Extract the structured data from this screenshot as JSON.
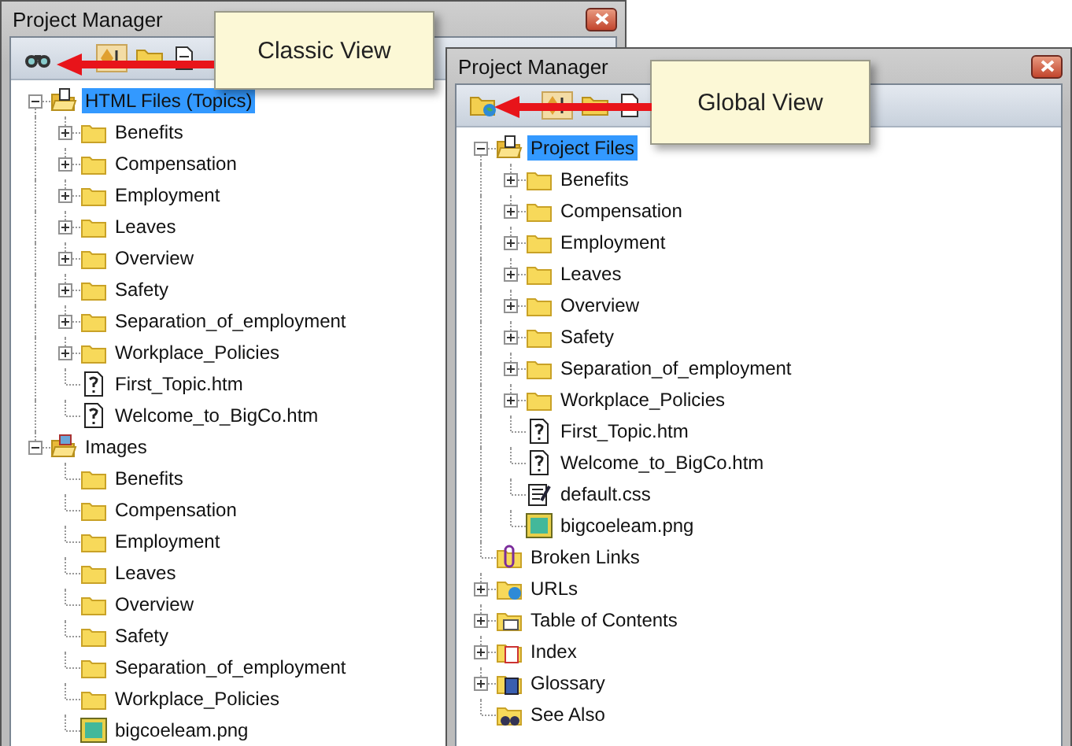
{
  "windows": [
    {
      "title": "Project Manager",
      "callout": "Classic View",
      "tree": [
        {
          "label": "HTML Files (Topics)",
          "kind": "topics",
          "selected": true,
          "expanded": true,
          "children": [
            {
              "label": "Benefits",
              "kind": "folder",
              "selected": false,
              "expanded": false
            },
            {
              "label": "Compensation",
              "kind": "folder",
              "selected": false,
              "expanded": false
            },
            {
              "label": "Employment",
              "kind": "folder",
              "selected": false,
              "expanded": false
            },
            {
              "label": "Leaves",
              "kind": "folder",
              "selected": false,
              "expanded": false
            },
            {
              "label": "Overview",
              "kind": "folder",
              "selected": false,
              "expanded": false
            },
            {
              "label": "Safety",
              "kind": "folder",
              "selected": false,
              "expanded": false
            },
            {
              "label": "Separation_of_employment",
              "kind": "folder",
              "selected": false,
              "expanded": false
            },
            {
              "label": "Workplace_Policies",
              "kind": "folder",
              "selected": false,
              "expanded": false
            },
            {
              "label": "First_Topic.htm",
              "kind": "topic",
              "selected": false
            },
            {
              "label": "Welcome_to_BigCo.htm",
              "kind": "topic",
              "selected": false
            }
          ]
        },
        {
          "label": "Images",
          "kind": "images",
          "selected": false,
          "expanded": true,
          "children": [
            {
              "label": "Benefits",
              "kind": "folder",
              "selected": false
            },
            {
              "label": "Compensation",
              "kind": "folder",
              "selected": false
            },
            {
              "label": "Employment",
              "kind": "folder",
              "selected": false
            },
            {
              "label": "Leaves",
              "kind": "folder",
              "selected": false
            },
            {
              "label": "Overview",
              "kind": "folder",
              "selected": false
            },
            {
              "label": "Safety",
              "kind": "folder",
              "selected": false
            },
            {
              "label": "Separation_of_employment",
              "kind": "folder",
              "selected": false
            },
            {
              "label": "Workplace_Policies",
              "kind": "folder",
              "selected": false
            },
            {
              "label": "bigcoeleam.png",
              "kind": "image",
              "selected": false
            }
          ]
        }
      ]
    },
    {
      "title": "Project Manager",
      "callout": "Global View",
      "tree": [
        {
          "label": "Project Files",
          "kind": "topics",
          "selected": true,
          "expanded": true,
          "children": [
            {
              "label": "Benefits",
              "kind": "folder",
              "selected": false,
              "expanded": false
            },
            {
              "label": "Compensation",
              "kind": "folder",
              "selected": false,
              "expanded": false
            },
            {
              "label": "Employment",
              "kind": "folder",
              "selected": false,
              "expanded": false
            },
            {
              "label": "Leaves",
              "kind": "folder",
              "selected": false,
              "expanded": false
            },
            {
              "label": "Overview",
              "kind": "folder",
              "selected": false,
              "expanded": false
            },
            {
              "label": "Safety",
              "kind": "folder",
              "selected": false,
              "expanded": false
            },
            {
              "label": "Separation_of_employment",
              "kind": "folder",
              "selected": false,
              "expanded": false
            },
            {
              "label": "Workplace_Policies",
              "kind": "folder",
              "selected": false,
              "expanded": false
            },
            {
              "label": "First_Topic.htm",
              "kind": "topic",
              "selected": false
            },
            {
              "label": "Welcome_to_BigCo.htm",
              "kind": "topic",
              "selected": false
            },
            {
              "label": "default.css",
              "kind": "css",
              "selected": false
            },
            {
              "label": "bigcoeleam.png",
              "kind": "image",
              "selected": false
            }
          ]
        },
        {
          "label": "Broken Links",
          "kind": "broken-links",
          "selected": false
        },
        {
          "label": "URLs",
          "kind": "urls",
          "selected": false,
          "expanded": false
        },
        {
          "label": "Table of Contents",
          "kind": "toc",
          "selected": false,
          "expanded": false
        },
        {
          "label": "Index",
          "kind": "index",
          "selected": false,
          "expanded": false
        },
        {
          "label": "Glossary",
          "kind": "glossary",
          "selected": false,
          "expanded": false
        },
        {
          "label": "See Also",
          "kind": "see-also",
          "selected": false
        }
      ]
    }
  ]
}
